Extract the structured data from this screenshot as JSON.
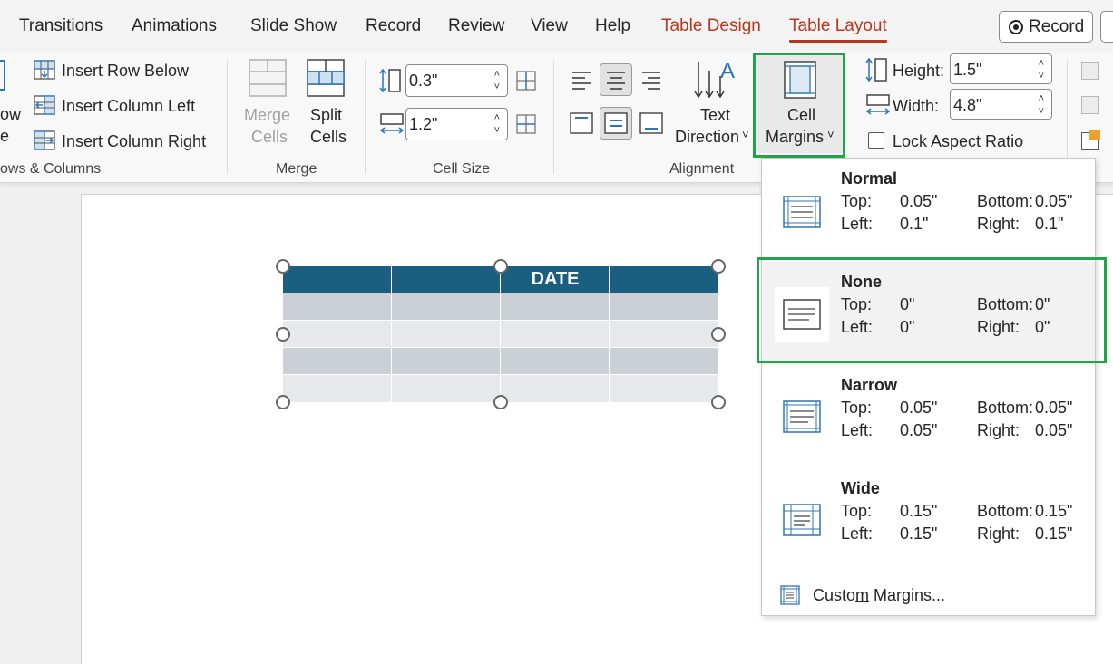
{
  "tabs": [
    {
      "label": "Transitions",
      "state": "normal"
    },
    {
      "label": "Animations",
      "state": "normal"
    },
    {
      "label": "Slide Show",
      "state": "normal"
    },
    {
      "label": "Record",
      "state": "normal"
    },
    {
      "label": "Review",
      "state": "normal"
    },
    {
      "label": "View",
      "state": "normal"
    },
    {
      "label": "Help",
      "state": "normal"
    },
    {
      "label": "Table Design",
      "state": "contextual"
    },
    {
      "label": "Table Layout",
      "state": "active"
    }
  ],
  "record_button": {
    "label": "Record"
  },
  "ribbon": {
    "rows_columns": {
      "partial_top": "ow",
      "partial_bottom": "e",
      "insert_row_below": "Insert Row Below",
      "insert_column_left": "Insert Column Left",
      "insert_column_right": "Insert Column Right",
      "group_label": "ows & Columns"
    },
    "merge": {
      "merge_line1": "Merge",
      "merge_line2": "Cells",
      "split_line1": "Split",
      "split_line2": "Cells",
      "group_label": "Merge"
    },
    "cell_size": {
      "height_value": "0.3\"",
      "width_value": "1.2\"",
      "group_label": "Cell Size"
    },
    "alignment": {
      "text_direction_line1": "Text",
      "text_direction_line2": "Direction",
      "cell_margins_line1": "Cell",
      "cell_margins_line2": "Margins",
      "group_label": "Alignment"
    },
    "table_size": {
      "height_label": "Height:",
      "height_value": "1.5\"",
      "width_label": "Width:",
      "width_value": "4.8\"",
      "lock_label": "Lock Aspect Ratio",
      "lock_checked": false
    }
  },
  "slide_table": {
    "header": [
      "",
      "",
      "DATE",
      ""
    ],
    "header_color": "#1a5e80",
    "row_colors": [
      "#cbcfd6",
      "#e6e8eb",
      "#cbcfd6",
      "#e6e8eb"
    ]
  },
  "cell_margins_menu": {
    "options": [
      {
        "name": "Normal",
        "top_label": "Top:",
        "top": "0.05\"",
        "bottom_label": "Bottom:",
        "bottom": "0.05\"",
        "left_label": "Left:",
        "left": "0.1\"",
        "right_label": "Right:",
        "right": "0.1\""
      },
      {
        "name": "None",
        "top_label": "Top:",
        "top": "0\"",
        "bottom_label": "Bottom:",
        "bottom": "0\"",
        "left_label": "Left:",
        "left": "0\"",
        "right_label": "Right:",
        "right": "0\""
      },
      {
        "name": "Narrow",
        "top_label": "Top:",
        "top": "0.05\"",
        "bottom_label": "Bottom:",
        "bottom": "0.05\"",
        "left_label": "Left:",
        "left": "0.05\"",
        "right_label": "Right:",
        "right": "0.05\""
      },
      {
        "name": "Wide",
        "top_label": "Top:",
        "top": "0.15\"",
        "bottom_label": "Bottom:",
        "bottom": "0.15\"",
        "left_label": "Left:",
        "left": "0.15\"",
        "right_label": "Right:",
        "right": "0.15\""
      }
    ],
    "custom_prefix": "Custo",
    "custom_underlined": "m",
    "custom_suffix": " Margins..."
  },
  "colors": {
    "accent": "#b5371e",
    "highlight_green": "#22a548",
    "icon_blue": "#2e75b6"
  }
}
